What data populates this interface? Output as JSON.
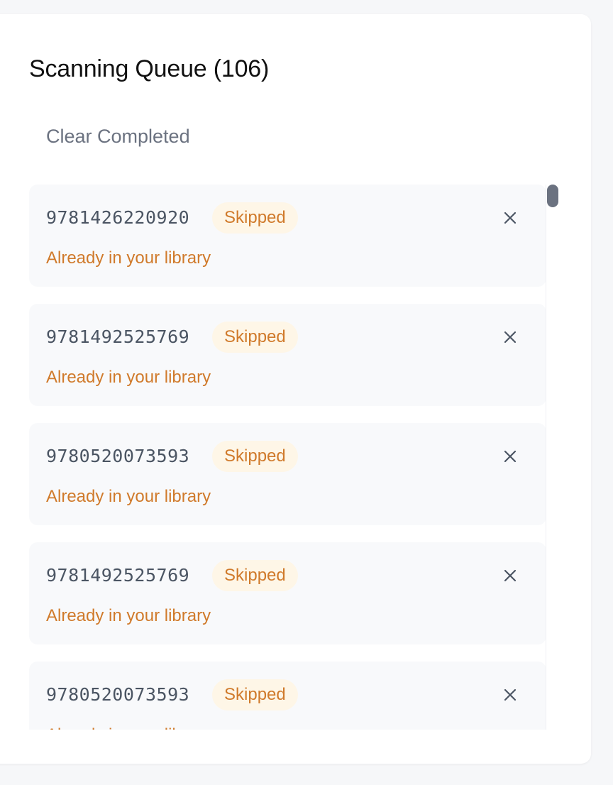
{
  "queue": {
    "title": "Scanning Queue (106)",
    "clear_label": "Clear Completed",
    "items": [
      {
        "isbn": "9781426220920",
        "status": "Skipped",
        "message": "Already in your library"
      },
      {
        "isbn": "9781492525769",
        "status": "Skipped",
        "message": "Already in your library"
      },
      {
        "isbn": "9780520073593",
        "status": "Skipped",
        "message": "Already in your library"
      },
      {
        "isbn": "9781492525769",
        "status": "Skipped",
        "message": "Already in your library"
      },
      {
        "isbn": "9780520073593",
        "status": "Skipped",
        "message": "Already in your library"
      }
    ]
  },
  "icons": {
    "remove": "close-icon"
  },
  "colors": {
    "status_skipped_text": "#d07a2b",
    "status_skipped_bg": "#fef6e7",
    "scrollbar_thumb": "#6b7280"
  }
}
